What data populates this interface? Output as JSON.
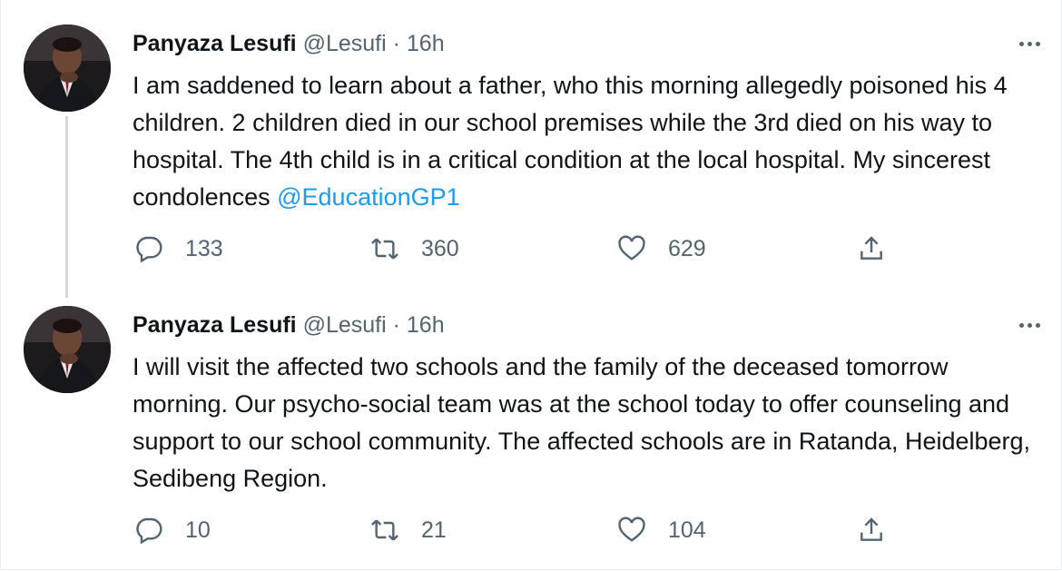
{
  "tweets": [
    {
      "author_name": "Panyaza Lesufi",
      "handle": "@Lesufi",
      "separator": " · ",
      "time": "16h",
      "text_before": "I am saddened to learn about a father, who this morning allegedly poisoned his 4 children. 2 children died in our school premises while the 3rd died on his way to hospital. The 4th child is in a critical condition at the local hospital. My sincerest condolences ",
      "mention": "@EducationGP1",
      "replies": "133",
      "retweets": "360",
      "likes": "629"
    },
    {
      "author_name": "Panyaza Lesufi",
      "handle": "@Lesufi",
      "separator": " · ",
      "time": "16h",
      "text_before": "I will visit the affected two schools and the family of the deceased tomorrow morning. Our psycho-social team was at the school today to offer counseling and support to our school community. The affected schools are in Ratanda, Heidelberg, Sedibeng Region.",
      "mention": "",
      "replies": "10",
      "retweets": "21",
      "likes": "104"
    }
  ],
  "colors": {
    "text": "#0f1419",
    "meta": "#536471",
    "link": "#1d9bf0",
    "thread_line": "#cfd9de"
  },
  "icons": [
    "avatar",
    "more-icon",
    "reply-icon",
    "retweet-icon",
    "like-icon",
    "share-icon"
  ]
}
